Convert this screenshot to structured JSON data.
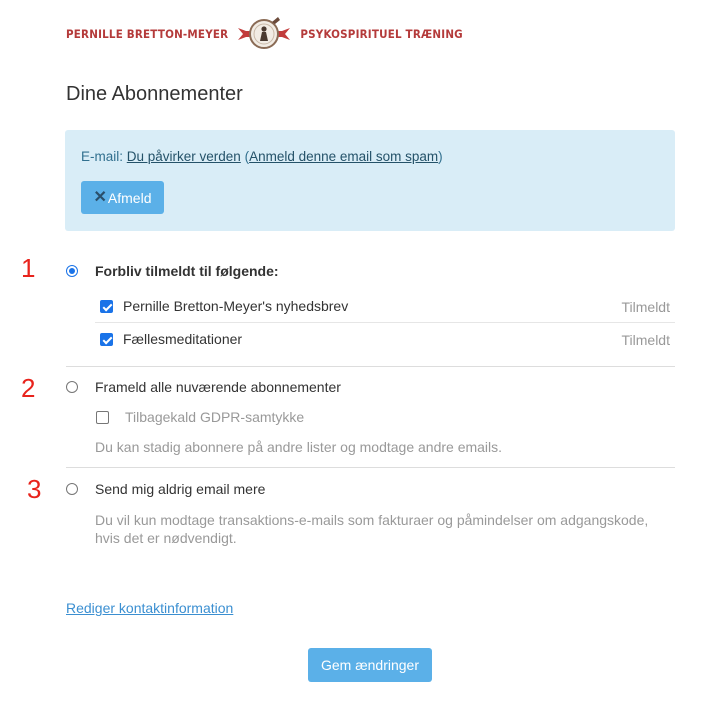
{
  "brand": {
    "name_left": "Pernille Bretton-Meyer",
    "name_right": "Psykospirituel Træning"
  },
  "page": {
    "title": "Dine Abonnementer"
  },
  "email_notice": {
    "prefix": "E-mail: ",
    "email_link": "Du påvirker verden",
    "open_paren": " (",
    "spam_link": "Anmeld denne email som spam",
    "close_paren": ")",
    "unsubscribe_label": "Afmeld"
  },
  "options": {
    "stay": {
      "number": "1",
      "label": "Forbliv tilmeldt til følgende:",
      "selected": true,
      "lists": [
        {
          "name": "Pernille Bretton-Meyer's nyhedsbrev",
          "status": "Tilmeldt",
          "checked": true
        },
        {
          "name": "Fællesmeditationer",
          "status": "Tilmeldt",
          "checked": true
        }
      ]
    },
    "unsubscribe_all": {
      "number": "2",
      "label": "Frameld alle nuværende abonnementer",
      "selected": false,
      "gdpr_label": "Tilbagekald GDPR-samtykke",
      "gdpr_checked": false,
      "note": "Du kan stadig abonnere på andre lister og modtage andre emails."
    },
    "never": {
      "number": "3",
      "label": "Send mig aldrig email mere",
      "selected": false,
      "note_line1": "Du vil kun modtage transaktions-e-mails som fakturaer og påmindelser om adgangskode,",
      "note_line2": "hvis det er nødvendigt."
    }
  },
  "edit_contact_link": "Rediger kontaktinformation",
  "save_button": "Gem ændringer",
  "colors": {
    "accent": "#5bb0e8",
    "notice_bg": "#d9edf7",
    "brand_red": "#b43a3a",
    "number_red": "#e8231c"
  }
}
